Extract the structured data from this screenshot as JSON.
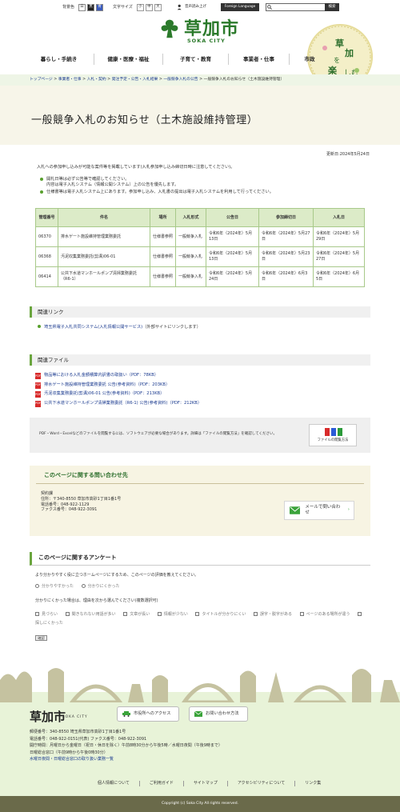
{
  "header": {
    "bgcolor_label": "背景色",
    "bgcolor_options": [
      "白",
      "黒",
      "青"
    ],
    "fontsize_label": "文字サイズ",
    "fontsize_options": [
      "小",
      "中",
      "大"
    ],
    "read_aloud": "音声読み上げ",
    "foreign_language": "Foreign Language",
    "search_button": "検索",
    "logo_name": "草加市",
    "logo_sub": "SOKA CITY",
    "emblem_text": "草加を楽しむ"
  },
  "nav": [
    "暮らし・手続き",
    "健康・医療・福祉",
    "子育て・教育",
    "事業者・仕事",
    "市政"
  ],
  "breadcrumb": {
    "links": [
      "トップページ",
      "事業者・仕事",
      "入札・契約",
      "発注予定・公告・入札結果",
      "一般競争入札の公告"
    ],
    "sep": " > ",
    "current": "一般競争入札のお知らせ（土木施設維持管理）"
  },
  "page": {
    "title": "一般競争入札のお知らせ（土木施設維持管理）",
    "updated": "更新日:2024年5月24日",
    "intro": "入札への参加申し込みが可能な案件等を掲載しています(入札参加申し込み締切日時に注意してください)。",
    "notes": [
      "開札日等は必ず公告等で確認してください。",
      "内容は電子入札システム（情報公開システム）上の公告を優先します。",
      "仕様書等は電子入札システム上にあります。参加申し込み、入札書の提出は電子入札システムを利用して行ってください。"
    ]
  },
  "table": {
    "headers": [
      "管理番号",
      "件名",
      "場所",
      "入札形式",
      "公告日",
      "参加締切日",
      "入札日"
    ],
    "rows": [
      [
        "06370",
        "排水ゲート施設維持管理業務委託",
        "仕様書参照",
        "一般競争入札",
        "令和6年（2024年）5月13日",
        "令和6年（2024年）5月27日",
        "令和6年（2024年）5月29日"
      ],
      [
        "06368",
        "汚泥収集業務委託(剪溝)06-01",
        "仕様書参照",
        "一般競争入札",
        "令和6年（2024年）5月13日",
        "令和6年（2024年）5月23日",
        "令和6年（2024年）5月27日"
      ],
      [
        "06414",
        "公共下水道マンホールポンプ清掃業務委託（R6-1）",
        "仕様書参照",
        "一般競争入札",
        "令和6年（2024年）5月24日",
        "令和6年（2024年）6月3日",
        "令和6年（2024年）6月5日"
      ]
    ]
  },
  "related_links": {
    "heading": "関連リンク",
    "link": "埼玉県電子入札共同システム(入札情報公開サービス)",
    "note": "（外部サイトにリンクします）"
  },
  "related_files": {
    "heading": "関連ファイル",
    "files": [
      "物品等における入札金額積算内訳書の取扱い（PDF：78KB）",
      "排水ゲート施設維持管理業務委託 公告(参考資料)（PDF：203KB）",
      "汚泥収集業務委託(剪溝)06-01 公告(参考資料)（PDF：213KB）",
      "公共下水道マンホールポンプ清掃業務委託（R6-1) 公告(参考資料)（PDF：212KB）"
    ]
  },
  "viewer": {
    "text": "PDF・Word・Excelなどのファイルを閲覧するには、ソフトウェアが必要な場合があります。詳細は「ファイルの閲覧方法」を確認してください。",
    "button": "ファイルの閲覧方法"
  },
  "contact": {
    "heading": "このページに関する問い合わせ先",
    "dept": "契約課",
    "address": "住所：〒340-8550 草加市高砂1丁目1番1号",
    "phone": "電話番号：048-922-1129",
    "fax": "ファクス番号：048-922-3091",
    "mail_button": "メールで問い合わせ"
  },
  "survey": {
    "heading": "このページに関するアンケート",
    "q1": "より分かりやすく役に立つホームページにするため、このページの評価を教えてください。",
    "q1_options": [
      "分かりやすかった",
      "分かりにくかった"
    ],
    "q2": "分かりにくかった場合は、理由を次から選んでください(複数選択可)",
    "q2_options": [
      "見づらい",
      "聞きなれない用語が多い",
      "文章が長い",
      "情報が少ない",
      "タイトルが分かりにくい",
      "誤字・脱字がある",
      "ページのある場所が違う",
      "探しにくかった"
    ],
    "submit": "確認"
  },
  "footer": {
    "name": "草加市",
    "sub": "SOKA CITY",
    "access_button": "市役所へのアクセス",
    "inquiry_button": "お問い合わせ方法",
    "address": "郵便番号：340-8550 埼玉県草加市高砂1丁目1番1号",
    "phone": "電話番号：048-922-0151(代表)  ファクス番号：048-922-3091",
    "hours": "開庁時間：月曜日から金曜日（祝日・休日を除く）午前8時30分から午後5時／水曜日夜間（午後9時まで）",
    "sunday": "日曜総合窓口（午前9時から午後0時30分）",
    "link": "水曜日夜間・日曜総合窓口の取り扱い業務一覧",
    "links": [
      "個人情報について",
      "ご利用ガイド",
      "サイトマップ",
      "アクセシビリティについて",
      "リンク集"
    ],
    "copyright": "Copyright (c) Soka City All rights reserved."
  },
  "colors": {
    "accent": "#2b7a2b",
    "table_header": "#dcebc8",
    "footer_bg": "#e8f3d8",
    "copy_bg": "#6a6a4a"
  }
}
